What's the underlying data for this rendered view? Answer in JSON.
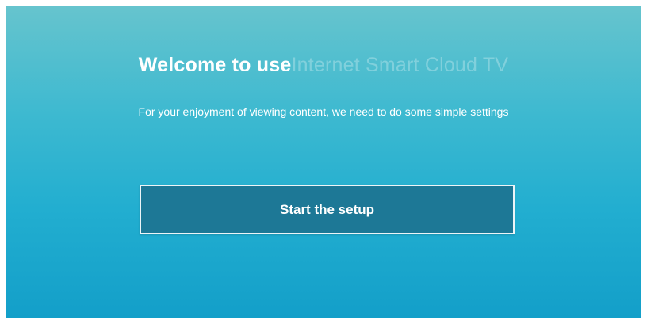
{
  "welcome": {
    "title_lead": "Welcome to use",
    "title_brand": "Internet Smart Cloud TV",
    "subtitle": "For your enjoyment of viewing content, we need to do some simple settings"
  },
  "actions": {
    "start_setup_label": "Start the setup"
  },
  "colors": {
    "background_top": "#66c4ce",
    "background_bottom": "#139fc9",
    "button_fill": "#1d7896",
    "text": "#ffffff"
  }
}
